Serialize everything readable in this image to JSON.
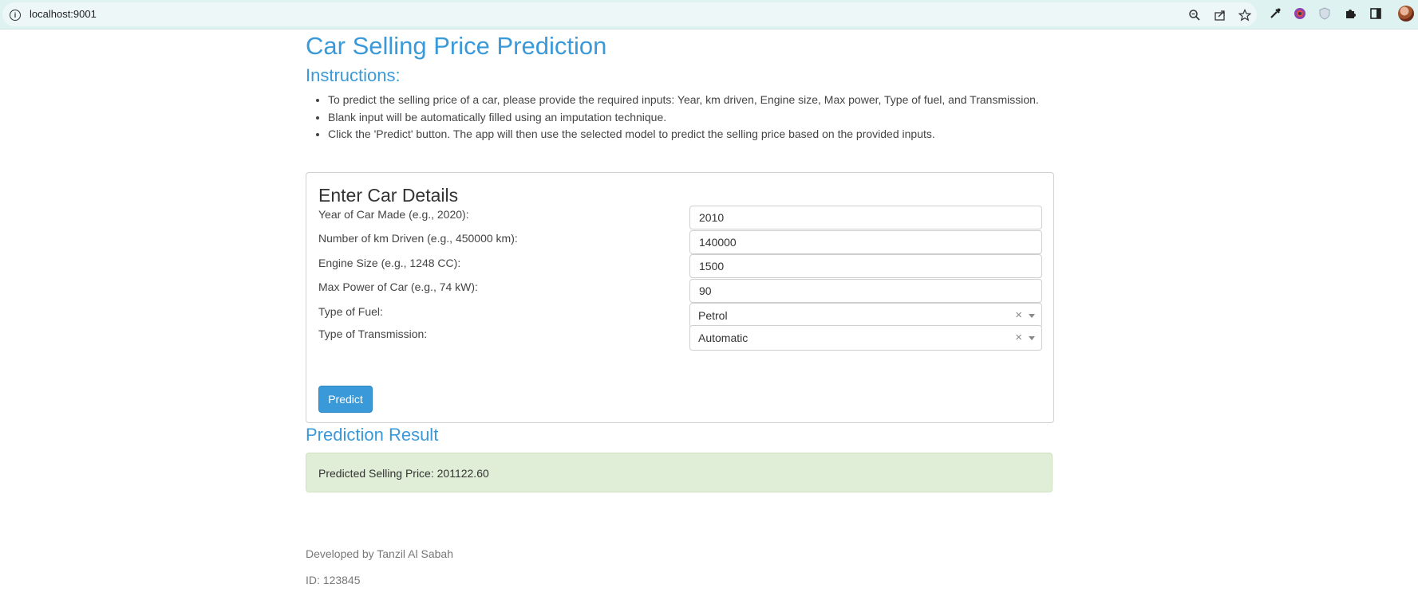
{
  "browser": {
    "url": "localhost:9001"
  },
  "page": {
    "title": "Car Selling Price Prediction",
    "instructions_heading": "Instructions:",
    "instructions": [
      "To predict the selling price of a car, please provide the required inputs: Year, km driven, Engine size, Max power, Type of fuel, and Transmission.",
      "Blank input will be automatically filled using an imputation technique.",
      "Click the 'Predict' button. The app will then use the selected model to predict the selling price based on the provided inputs."
    ]
  },
  "form": {
    "heading": "Enter Car Details",
    "year": {
      "label": "Year of Car Made (e.g., 2020):",
      "value": "2010"
    },
    "km": {
      "label": "Number of km Driven (e.g., 450000 km):",
      "value": "140000"
    },
    "engine": {
      "label": "Engine Size (e.g., 1248 CC):",
      "value": "1500"
    },
    "power": {
      "label": "Max Power of Car (e.g., 74 kW):",
      "value": "90"
    },
    "fuel": {
      "label": "Type of Fuel:",
      "value": "Petrol"
    },
    "transmission": {
      "label": "Type of Transmission:",
      "value": "Automatic"
    },
    "predict_label": "Predict"
  },
  "result": {
    "heading": "Prediction Result",
    "text": "Predicted Selling Price: 201122.60"
  },
  "footer": {
    "developer": "Developed by Tanzil Al Sabah",
    "id": "ID: 123845"
  },
  "colors": {
    "accent": "#3a9ad9",
    "result_bg": "#e0eed7"
  }
}
